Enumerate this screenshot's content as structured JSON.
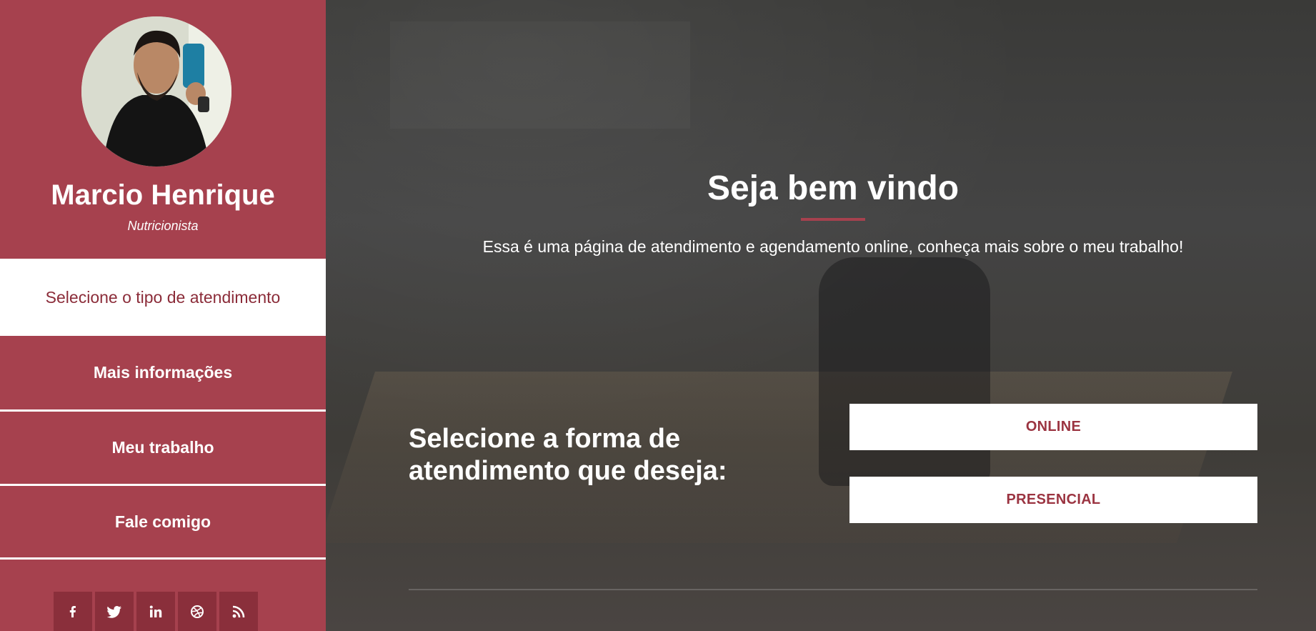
{
  "sidebar": {
    "profile": {
      "name": "Marcio Henrique",
      "role": "Nutricionista"
    },
    "nav": [
      {
        "label": "Selecione o tipo de atendimento",
        "active": true
      },
      {
        "label": "Mais informações",
        "active": false
      },
      {
        "label": "Meu trabalho",
        "active": false
      },
      {
        "label": "Fale comigo",
        "active": false
      }
    ],
    "social": [
      "facebook-icon",
      "twitter-icon",
      "linkedin-icon",
      "dribbble-icon",
      "rss-icon"
    ]
  },
  "main": {
    "title": "Seja bem vindo",
    "subtitle": "Essa é uma página de atendimento e agendamento online, conheça mais sobre o meu trabalho!",
    "prompt": "Selecione a forma de atendimento que deseja:",
    "options": [
      "ONLINE",
      "PRESENCIAL"
    ]
  },
  "colors": {
    "accent": "#a6414e",
    "accent_dark": "#8a2f3b",
    "active_text": "#8b2c39"
  }
}
